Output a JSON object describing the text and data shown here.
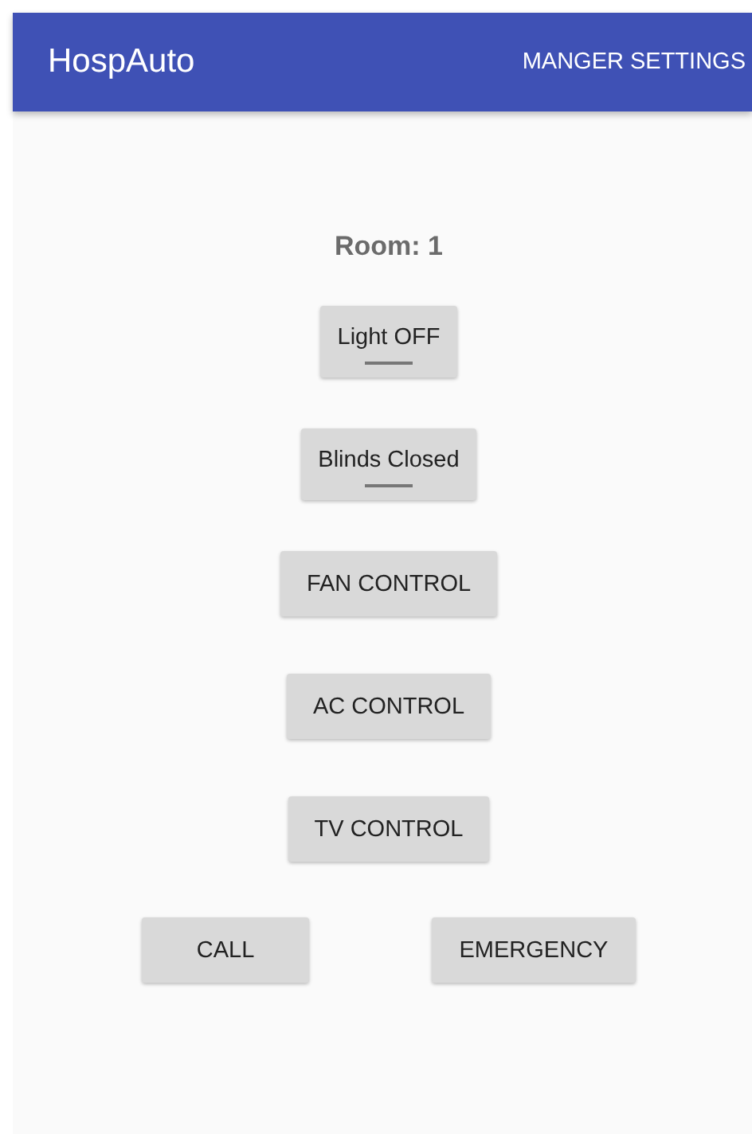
{
  "app_bar": {
    "title": "HospAuto",
    "action": "MANGER SETTINGS"
  },
  "room_label": "Room: 1",
  "controls": [
    {
      "kind": "toggle",
      "label": "Light OFF",
      "on": false
    },
    {
      "kind": "toggle",
      "label": "Blinds Closed",
      "on": false
    },
    {
      "kind": "button",
      "label": "FAN CONTROL"
    },
    {
      "kind": "button",
      "label": "AC CONTROL"
    },
    {
      "kind": "button",
      "label": "TV CONTROL"
    }
  ],
  "bottom_buttons": [
    "CALL",
    "EMERGENCY"
  ]
}
